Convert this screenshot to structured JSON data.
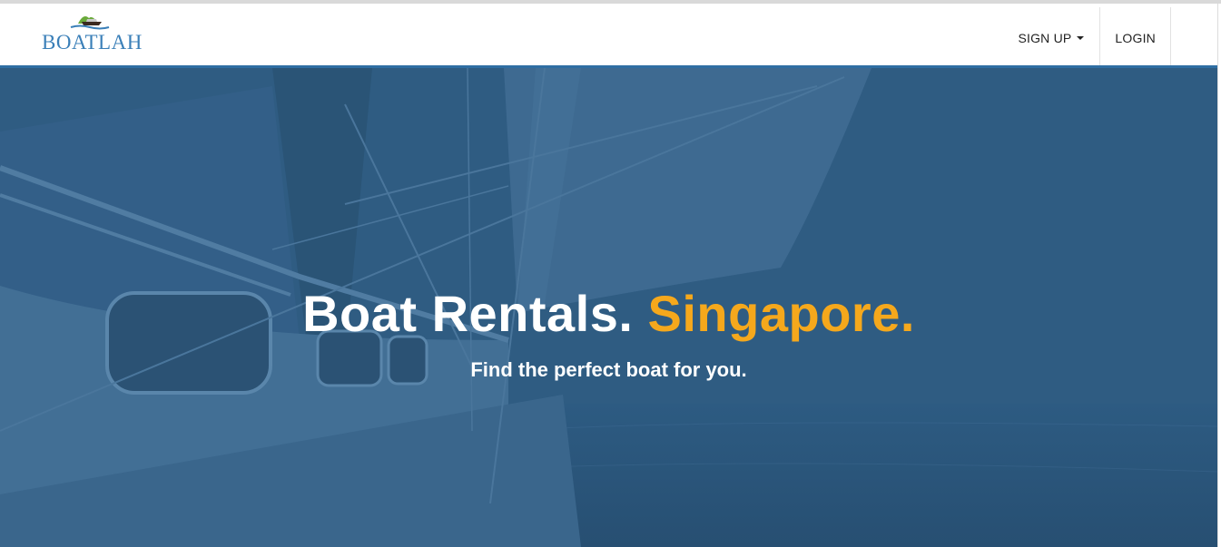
{
  "brand": {
    "name": "BOATLAH",
    "logo_icon": "boat-island-icon"
  },
  "nav": {
    "signup_label": "SIGN UP",
    "login_label": "LOGIN"
  },
  "hero": {
    "title_main": "Boat Rentals.",
    "title_accent": "Singapore.",
    "subtitle": "Find the perfect boat for you."
  },
  "colors": {
    "accent": "#f5a81c",
    "overlay": "#2e5a80",
    "brand_blue": "#3a7fb8",
    "nav_rule": "#2f6ea3"
  }
}
